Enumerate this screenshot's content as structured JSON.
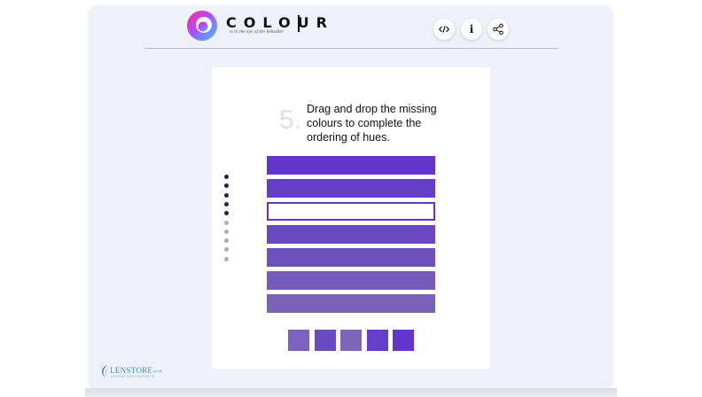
{
  "header": {
    "title": "COLOUR",
    "tagline": "is in the eye of the beholder",
    "buttons": [
      {
        "name": "embed",
        "icon": "code-icon"
      },
      {
        "name": "info",
        "icon": "info-icon",
        "glyph": "i"
      },
      {
        "name": "share",
        "icon": "share-icon"
      }
    ]
  },
  "question": {
    "number": "5.",
    "text": "Drag and drop the missing\ncolours to complete the\nordering of hues."
  },
  "progress": {
    "total": 10,
    "completed": 5,
    "colors": {
      "done": "#1c2745",
      "pending": "#a7aec0"
    }
  },
  "hue_bars": [
    {
      "color": "#6236c8",
      "filled": true
    },
    {
      "color": "#643ec6",
      "filled": true
    },
    {
      "color": "#5e36c2",
      "filled": false
    },
    {
      "color": "#6a48c0",
      "filled": true
    },
    {
      "color": "#6f51bd",
      "filled": true
    },
    {
      "color": "#755aba",
      "filled": true
    },
    {
      "color": "#7a62b9",
      "filled": true
    }
  ],
  "swatches": [
    "#7d62bd",
    "#6a4ac4",
    "#7c68b9",
    "#673ec9",
    "#6236c9"
  ],
  "footer": {
    "brand": "LENSTORE",
    "tld": ".co.uk",
    "subline": "VISION CARE EXPERTS"
  }
}
